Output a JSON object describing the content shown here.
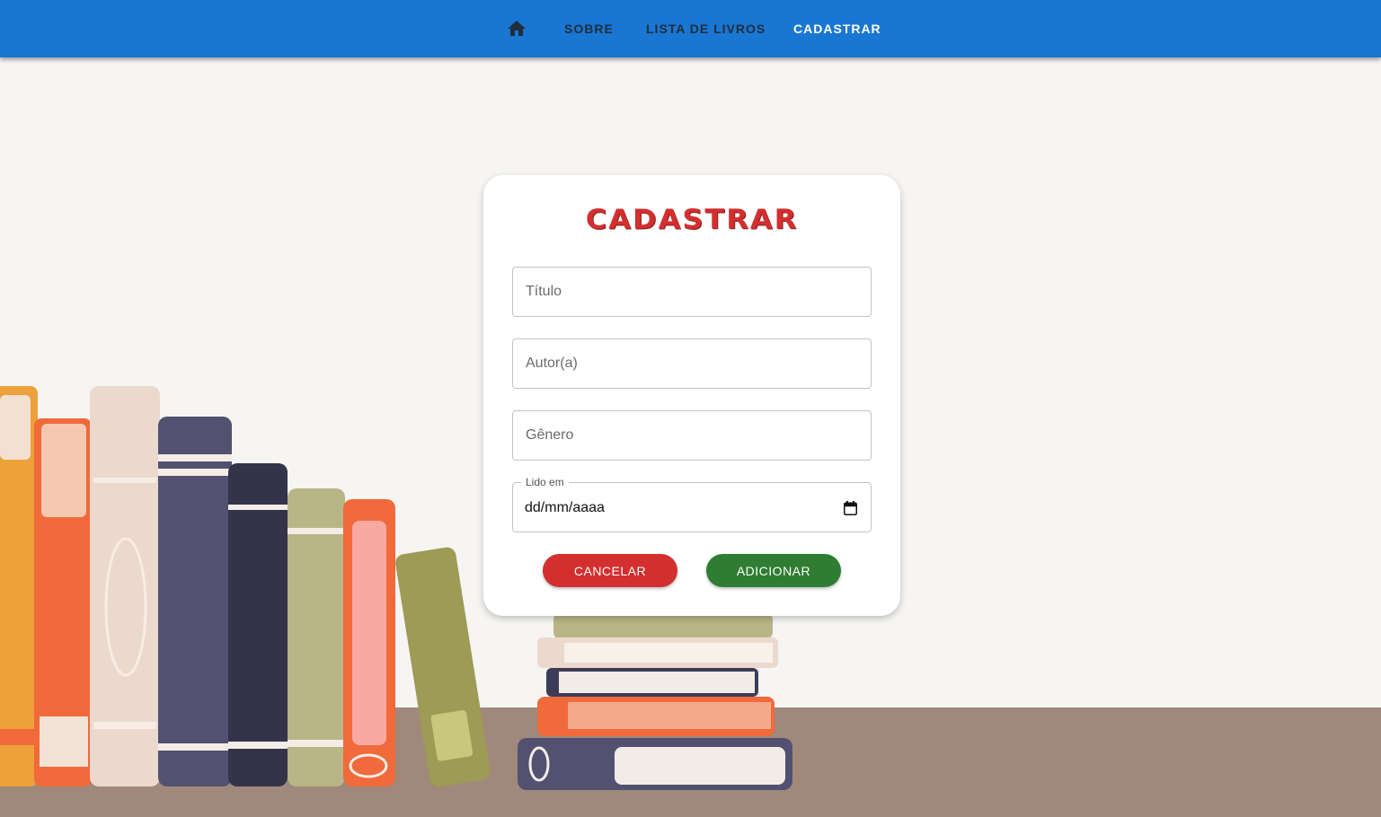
{
  "nav": {
    "home_icon": "home-icon",
    "items": [
      {
        "label": "SOBRE",
        "active": false
      },
      {
        "label": "LISTA DE LIVROS",
        "active": false
      },
      {
        "label": "CADASTRAR",
        "active": true
      }
    ]
  },
  "form": {
    "title": "CADASTRAR",
    "fields": {
      "titulo": {
        "placeholder": "Título",
        "value": ""
      },
      "autor": {
        "placeholder": "Autor(a)",
        "value": ""
      },
      "genero": {
        "placeholder": "Gênero",
        "value": ""
      },
      "lido_em": {
        "label": "Lido em",
        "value": "dd/mm/aaaa",
        "icon": "calendar-icon"
      }
    },
    "buttons": {
      "cancel": "CANCELAR",
      "add": "ADICIONAR"
    }
  },
  "colors": {
    "navbar": "#1976d2",
    "title": "#d32f2f",
    "cancel": "#d32f2f",
    "add": "#2e7d32",
    "floor": "#a0897a"
  }
}
